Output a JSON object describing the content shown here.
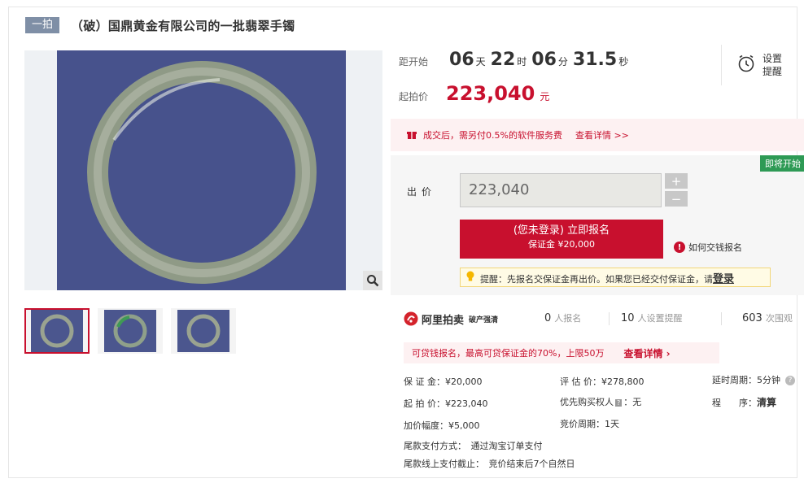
{
  "header": {
    "tag": "一拍",
    "title": "（破）国鼎黄金有限公司的一批翡翠手镯"
  },
  "countdown": {
    "label": "距开始",
    "days": "06",
    "days_unit": "天",
    "hours": "22",
    "hours_unit": "时",
    "minutes": "06",
    "minutes_unit": "分",
    "seconds": "31.5",
    "seconds_unit": "秒"
  },
  "start_price": {
    "label": "起拍价",
    "value": "223,040",
    "unit": "元"
  },
  "reminder": {
    "label": "设置提醒"
  },
  "fee_notice": {
    "text": "成交后，需另付0.5%的软件服务费",
    "link": "查看详情 >>"
  },
  "status_badge": "即将开始",
  "bid": {
    "label": "出价",
    "value": "223,040",
    "plus": "+",
    "minus": "−"
  },
  "signup_button": {
    "line1": "(您未登录) 立即报名",
    "line2": "保证金 ¥20,000"
  },
  "how_to_pay": {
    "icon": "!",
    "text": "如何交钱报名"
  },
  "tip": {
    "text": "提醒：先报名交保证金再出价。如果您已经交付保证金，请",
    "login": "登录"
  },
  "brand": {
    "name": "阿里拍卖",
    "sub": "破产强清"
  },
  "stats": [
    {
      "value": "0",
      "unit": "人报名"
    },
    {
      "value": "10",
      "unit": "人设置提醒"
    },
    {
      "value": "603",
      "unit": "次围观"
    }
  ],
  "promo": {
    "text": "可贷钱报名，最高可贷保证金的70%，上限50万",
    "link": "查看详情 ›"
  },
  "details": {
    "deposit": "保 证 金：¥20,000",
    "start": "起 拍 价：¥223,040",
    "increment": "加价幅度：¥5,000",
    "appraisal": "评 估 价：¥278,800",
    "priority_prefix": "优先购买权人",
    "priority_badge": "?",
    "priority_value": "：无",
    "cycle": "竞价周期：1天",
    "delay": "延时周期：5分钟",
    "procedure_label": "程　　序：",
    "procedure_value": "清算",
    "final_payment_method": "尾款支付方式：　通过淘宝订单支付",
    "final_payment_deadline": "尾款线上支付截止：　竞价结束后7个自然日"
  },
  "colors": {
    "accent": "#c8102e",
    "badge_green": "#2e9a55",
    "tag_bg": "#7f8fa6"
  }
}
